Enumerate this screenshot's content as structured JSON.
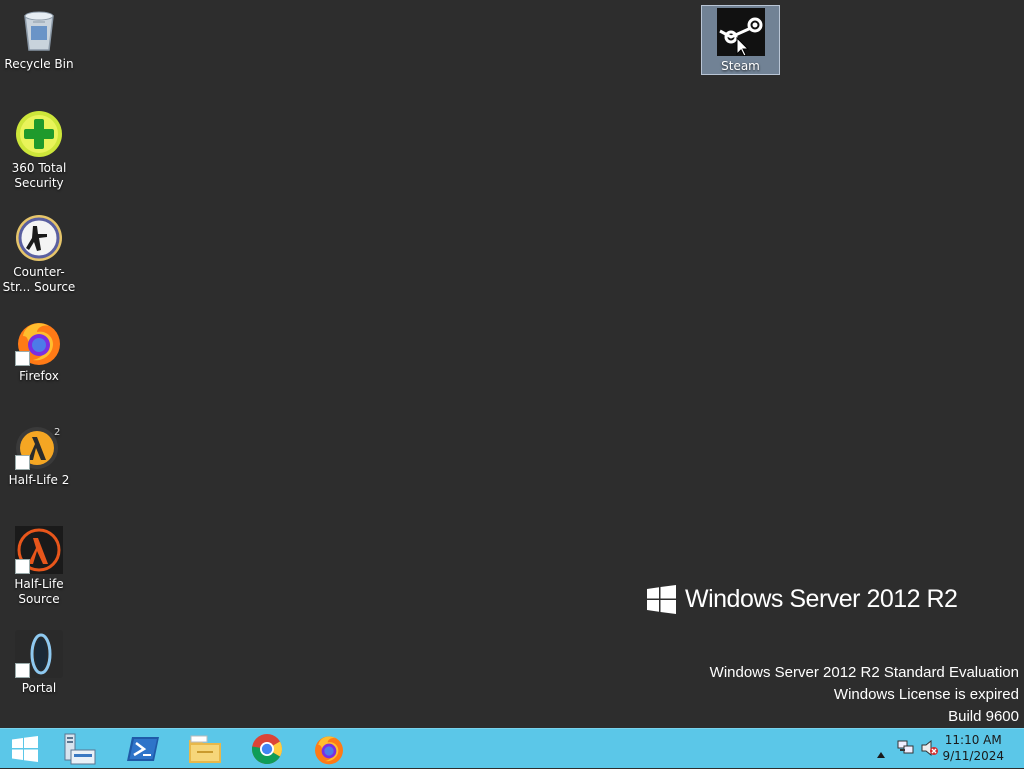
{
  "desktop": {
    "icons": [
      {
        "label": "Recycle Bin",
        "icon": "recycle-bin-icon"
      },
      {
        "label": "360 Total Security",
        "icon": "360-total-security-icon"
      },
      {
        "label": "Counter-Str... Source",
        "icon": "counter-strike-source-icon"
      },
      {
        "label": "Firefox",
        "icon": "firefox-icon"
      },
      {
        "label": "Half-Life 2",
        "icon": "half-life-2-icon"
      },
      {
        "label": "Half-Life Source",
        "icon": "half-life-source-icon"
      },
      {
        "label": "Portal",
        "icon": "portal-icon"
      },
      {
        "label": "Steam",
        "icon": "steam-icon",
        "selected": true
      }
    ]
  },
  "branding": {
    "logo_text": "Windows Server 2012 R2"
  },
  "watermark": {
    "line1": "Windows Server 2012 R2 Standard Evaluation",
    "line2": "Windows License is expired",
    "line3": "Build 9600"
  },
  "taskbar": {
    "color": "#5bc7e8",
    "pinned": [
      "start-icon",
      "server-manager-icon",
      "powershell-icon",
      "file-explorer-icon",
      "chrome-icon",
      "firefox-icon"
    ],
    "tray": {
      "icons": [
        "show-hidden-icons-icon",
        "network-icon",
        "volume-muted-icon"
      ],
      "time": "11:10 AM",
      "date": "9/11/2024"
    }
  }
}
